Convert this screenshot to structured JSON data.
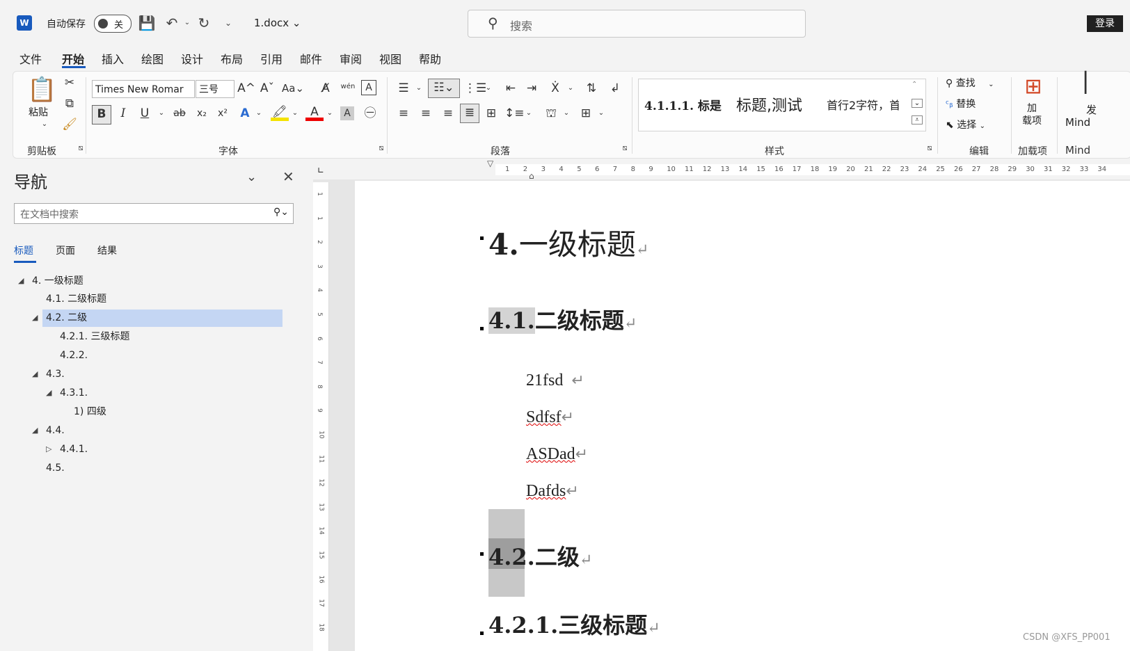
{
  "titlebar": {
    "app_logo": "W",
    "autosave_label": "自动保存",
    "autosave_state": "关",
    "filename": "1.docx",
    "search_placeholder": "搜索",
    "login": "登录"
  },
  "menu": {
    "tabs": [
      "文件",
      "开始",
      "插入",
      "绘图",
      "设计",
      "布局",
      "引用",
      "邮件",
      "审阅",
      "视图",
      "帮助"
    ],
    "active": "开始"
  },
  "ribbon": {
    "clipboard": {
      "paste": "粘贴",
      "label": "剪贴板"
    },
    "font": {
      "font_name": "Times New Romar",
      "font_size": "三号",
      "case": "Aa",
      "label": "字体",
      "wen": "wén",
      "bold": "B",
      "italic": "I",
      "underline": "U",
      "strike": "ab",
      "sub": "x₂",
      "sup": "x²"
    },
    "paragraph": {
      "label": "段落"
    },
    "styles": {
      "label": "样式",
      "style1": "4.1.1.1.  标是",
      "style2": "标题,测试",
      "style3": "首行2字符，首"
    },
    "editing": {
      "find": "查找",
      "replace": "替换",
      "select": "选择",
      "label": "编辑"
    },
    "addins": {
      "button": "加\n载项",
      "label": "加载项"
    },
    "mind": {
      "button": "Mind",
      "label": "Mind",
      "top": "发"
    }
  },
  "nav": {
    "title": "导航",
    "search_placeholder": "在文档中搜索",
    "tabs": [
      "标题",
      "页面",
      "结果"
    ],
    "items": [
      {
        "label": "4. 一级标题",
        "tri": "◢"
      },
      {
        "label": "4.1. 二级标题",
        "tri": ""
      },
      {
        "label": "4.2. 二级",
        "tri": "◢"
      },
      {
        "label": "4.2.1. 三级标题",
        "tri": ""
      },
      {
        "label": "4.2.2.",
        "tri": ""
      },
      {
        "label": "4.3.",
        "tri": "◢"
      },
      {
        "label": "4.3.1.",
        "tri": "◢"
      },
      {
        "label": "1) 四级",
        "tri": ""
      },
      {
        "label": "4.4.",
        "tri": "◢"
      },
      {
        "label": "4.4.1.",
        "tri": "▷"
      },
      {
        "label": "4.5.",
        "tri": ""
      }
    ]
  },
  "ruler": {
    "h_numbers": [
      "1",
      "2",
      "3",
      "4",
      "5",
      "6",
      "7",
      "8",
      "9",
      "10",
      "11",
      "12",
      "13",
      "14",
      "15",
      "16",
      "17",
      "18",
      "19",
      "20",
      "21",
      "22",
      "23",
      "24",
      "25",
      "26",
      "27",
      "28",
      "29",
      "30",
      "31",
      "32",
      "33",
      "34"
    ],
    "v_numbers": [
      "1",
      "1",
      "2",
      "3",
      "4",
      "5",
      "6",
      "7",
      "8",
      "9",
      "10",
      "11",
      "12",
      "13",
      "14",
      "15",
      "16",
      "17",
      "18"
    ]
  },
  "document": {
    "h1_num": "4.",
    "h1_text": "一级标题",
    "h2a_num": "4.1.",
    "h2a_text": "二级标题",
    "p1": "21fsd",
    "p2": "Sdfsf",
    "p3": "ASDad",
    "p4": "Dafds",
    "h2b_num": "4.2.",
    "h2b_text": "二级",
    "h3_num": "4.2.1.",
    "h3_text": "三级标题",
    "para_mark": "↵"
  },
  "watermark": "CSDN @XFS_PP001"
}
